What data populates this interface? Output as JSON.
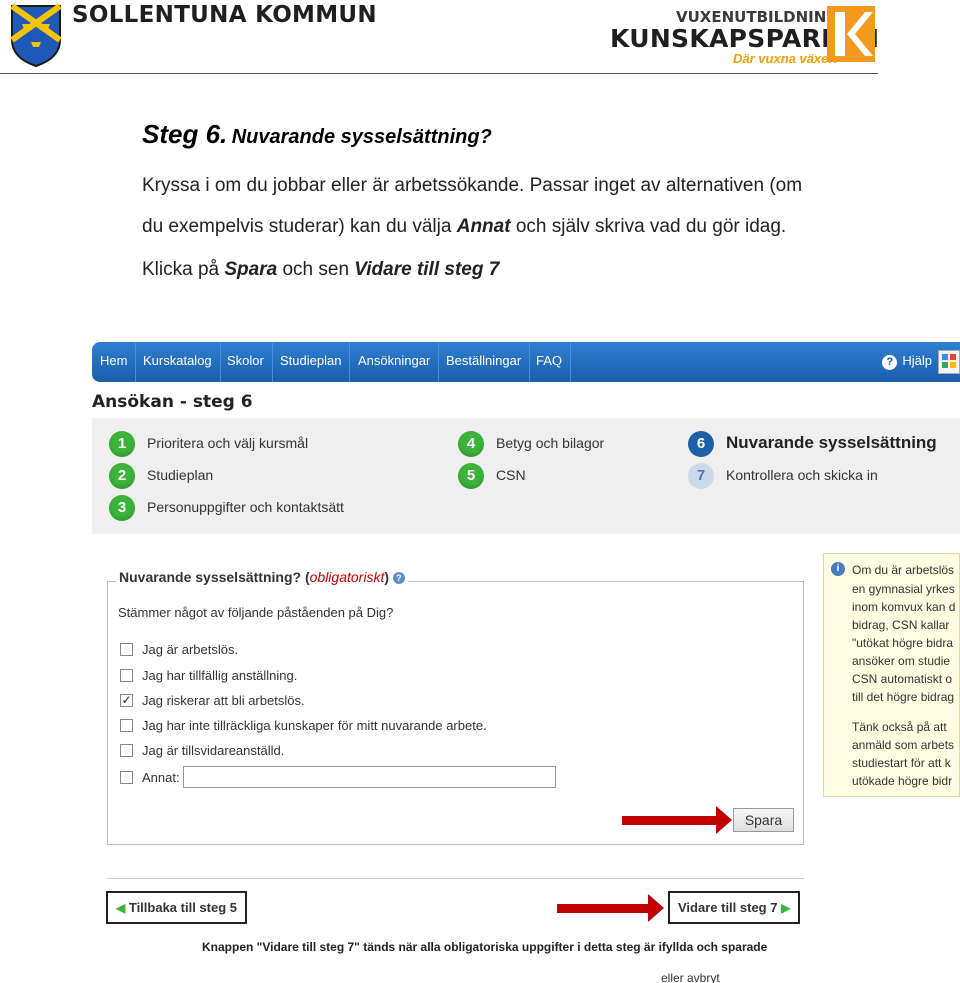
{
  "header": {
    "left_brand": "SOLLENTUNA KOMMUN",
    "right_brand_top": "VUXENUTBILDNING",
    "right_brand_main": "KUNSKAPSPARKEN",
    "right_slogan": "Där vuxna växer!"
  },
  "instructions": {
    "step_word": "Steg 6.",
    "step_subtitle": "Nuvarande sysselsättning?",
    "line1": "Kryssa i om du jobbar eller är arbetssökande. Passar inget av alternativen (om",
    "line2_pre": "du exempelvis studerar) kan du välja ",
    "line2_bold": "Annat",
    "line2_post": " och själv skriva vad du gör idag.",
    "line3_pre": "Klicka på ",
    "line3_bold1": "Spara",
    "line3_mid": " och sen ",
    "line3_bold2": "Vidare till steg 7"
  },
  "navbar": {
    "items": [
      "Hem",
      "Kurskatalog",
      "Skolor",
      "Studieplan",
      "Ansökningar",
      "Beställningar",
      "FAQ"
    ],
    "help": "Hjälp"
  },
  "page_heading": "Ansökan - steg 6",
  "steps": [
    {
      "num": "1",
      "label": "Prioritera och välj kursmål",
      "state": "done"
    },
    {
      "num": "2",
      "label": "Studieplan",
      "state": "done"
    },
    {
      "num": "3",
      "label": "Personuppgifter och kontaktsätt",
      "state": "done"
    },
    {
      "num": "4",
      "label": "Betyg och bilagor",
      "state": "done"
    },
    {
      "num": "5",
      "label": "CSN",
      "state": "done"
    },
    {
      "num": "6",
      "label": "Nuvarande sysselsättning",
      "state": "active"
    },
    {
      "num": "7",
      "label": "Kontrollera och skicka in",
      "state": "todo"
    }
  ],
  "form": {
    "legend": "Nuvarande sysselsättning? (",
    "legend_required": "obligatoriskt",
    "legend_close": ")",
    "question": "Stämmer något av följande påståenden på Dig?",
    "options": [
      {
        "label": "Jag är arbetslös.",
        "checked": false
      },
      {
        "label": "Jag har tillfällig anställning.",
        "checked": false
      },
      {
        "label": "Jag riskerar att bli arbetslös.",
        "checked": true
      },
      {
        "label": "Jag har inte tillräckliga kunskaper för mitt nuvarande arbete.",
        "checked": false
      },
      {
        "label": "Jag är tillsvidareanställd.",
        "checked": false
      },
      {
        "label": "Annat:",
        "checked": false
      }
    ],
    "annat_value": "",
    "save_button": "Spara"
  },
  "infobox": {
    "lines": [
      "Om du är arbetslös",
      "en gymnasial yrkes",
      "inom komvux kan d",
      "bidrag, CSN kallar",
      "\"utökat högre bidra",
      "ansöker om studie",
      "CSN automatiskt o",
      "till det högre bidrag",
      "",
      "Tänk också på att",
      "anmäld som arbets",
      "studiestart för att k",
      "utökade högre bidr"
    ]
  },
  "bottom": {
    "back_button": "Tillbaka till steg 5",
    "next_button": "Vidare till steg 7",
    "note": "Knappen \"Vidare till steg 7\" tänds när alla obligatoriska uppgifter i detta steg är ifyllda och sparade",
    "note2": "eller avbryt"
  },
  "icons": {
    "logo_left": "sollentuna-coat-of-arms-icon",
    "logo_right": "kunskapsparken-k-icon",
    "help": "help-icon",
    "google": "google-icon",
    "info": "info-icon",
    "arrow_left": "green-arrow-left-icon",
    "arrow_right": "green-arrow-right-icon",
    "red_arrow": "red-arrow-icon"
  },
  "colors": {
    "nav_blue": "#1b5fae",
    "step_green": "#3cb43c",
    "step_active": "#1f5fa8",
    "required_red": "#c00000",
    "annotation_arrow": "#c00000"
  }
}
